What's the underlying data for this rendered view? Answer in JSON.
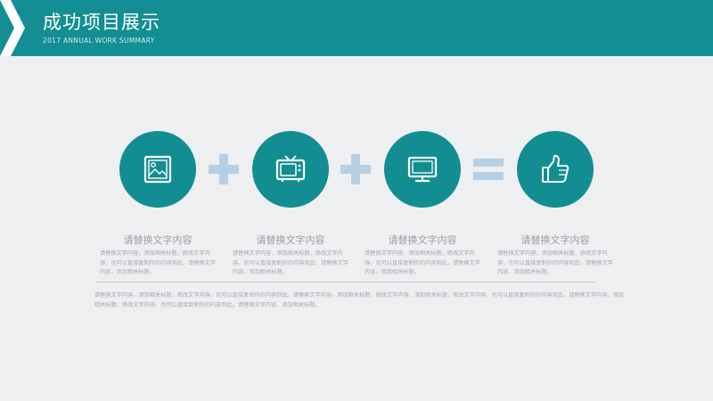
{
  "header": {
    "title": "成功项目展示",
    "subtitle": "2017 ANNUAL WORK SUMMARY"
  },
  "colors": {
    "header_bg": "#138f93",
    "circle_bg": "#128e92",
    "operator": "#b7cfe3",
    "background": "#eeeff1",
    "text_muted": "#a4a8ad"
  },
  "items": [
    {
      "icon": "picture-icon",
      "title": "请替换文字内容",
      "text": "请替换文字内容，添加相关标题，修改文字内容，也可以直接复制你的内容到此，请替换文字内容，添加相关标题。"
    },
    {
      "icon": "tv-icon",
      "title": "请替换文字内容",
      "text": "请替换文字内容，添加相关标题，修改文字内容，也可以直接复制你的内容到此，请替换文字内容，添加相关标题。"
    },
    {
      "icon": "monitor-icon",
      "title": "请替换文字内容",
      "text": "请替换文字内容，添加相关标题，修改文字内容，也可以直接复制你的内容到此，请替换文字内容，添加相关标题。"
    },
    {
      "icon": "thumbs-up-icon",
      "title": "请替换文字内容",
      "text": "请替换文字内容，添加相关标题，修改文字内容，也可以直接复制你的内容到此，请替换文字内容，添加相关标题。"
    }
  ],
  "operators": [
    "plus",
    "plus",
    "equals"
  ],
  "footer": {
    "text": "请替换文字内容，添加相关标题，修改文字内容，也可以直接复制你的内容到此。请替换文字内容，添加相关标题，修改文字内容，添加相关标题，修改文字内容，也可以直接复制你的内容到此。请替换文字内容，添加相关标题，修改文字内容，也可以直接复制你的内容到此。请替换文字内容，添加相关标题。"
  }
}
